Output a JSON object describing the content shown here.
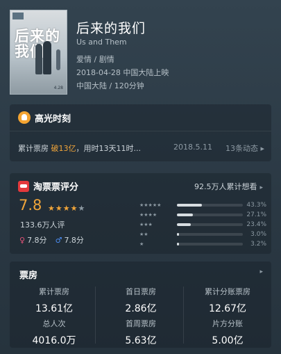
{
  "movie": {
    "title": "后来的我们",
    "title_en": "Us and Them",
    "genre": "爱情 / 剧情",
    "release": "2018-04-28 中国大陆上映",
    "region_duration": "中国大陆 / 120分钟",
    "poster": {
      "title_text": "后来的我们",
      "footer_text": "4.28"
    }
  },
  "highlight": {
    "title": "高光时刻",
    "text_prefix": "累计票房 ",
    "text_highlight": "破13亿",
    "text_suffix": "，用时13天11时...",
    "date": "2018.5.11",
    "more": "13条动态 ▸"
  },
  "taopiao": {
    "title": "淘票票评分",
    "want": "92.5万人累计想看",
    "score": "7.8",
    "stars": {
      "value": 4,
      "max": 5
    },
    "rating_count": "133.6万人评",
    "female_score": "7.8分",
    "male_score": "7.8分",
    "distribution": [
      {
        "stars": 5,
        "percent": 43.3,
        "label": "43.3%"
      },
      {
        "stars": 4,
        "percent": 27.1,
        "label": "27.1%"
      },
      {
        "stars": 3,
        "percent": 23.4,
        "label": "23.4%"
      },
      {
        "stars": 2,
        "percent": 3.0,
        "label": "3.0%"
      },
      {
        "stars": 1,
        "percent": 3.2,
        "label": "3.2%"
      }
    ]
  },
  "box_office": {
    "title": "票房",
    "cells": [
      {
        "label": "累计票房",
        "value": "13.61亿"
      },
      {
        "label": "首日票房",
        "value": "2.86亿"
      },
      {
        "label": "累计分账票房",
        "value": "12.67亿"
      },
      {
        "label": "总人次",
        "value": "4016.0万"
      },
      {
        "label": "首周票房",
        "value": "5.63亿"
      },
      {
        "label": "片方分账",
        "value": "5.00亿"
      }
    ]
  },
  "colors": {
    "accent": "#f0a53a",
    "taopiao_red": "#e4393c",
    "female": "#e8547a",
    "male": "#4b8cf2"
  },
  "icons": {
    "highlight": "trophy-icon",
    "taopiao": "taopiao-logo-icon",
    "female": "female-icon",
    "male": "male-icon",
    "chevron": "chevron-right-icon"
  }
}
